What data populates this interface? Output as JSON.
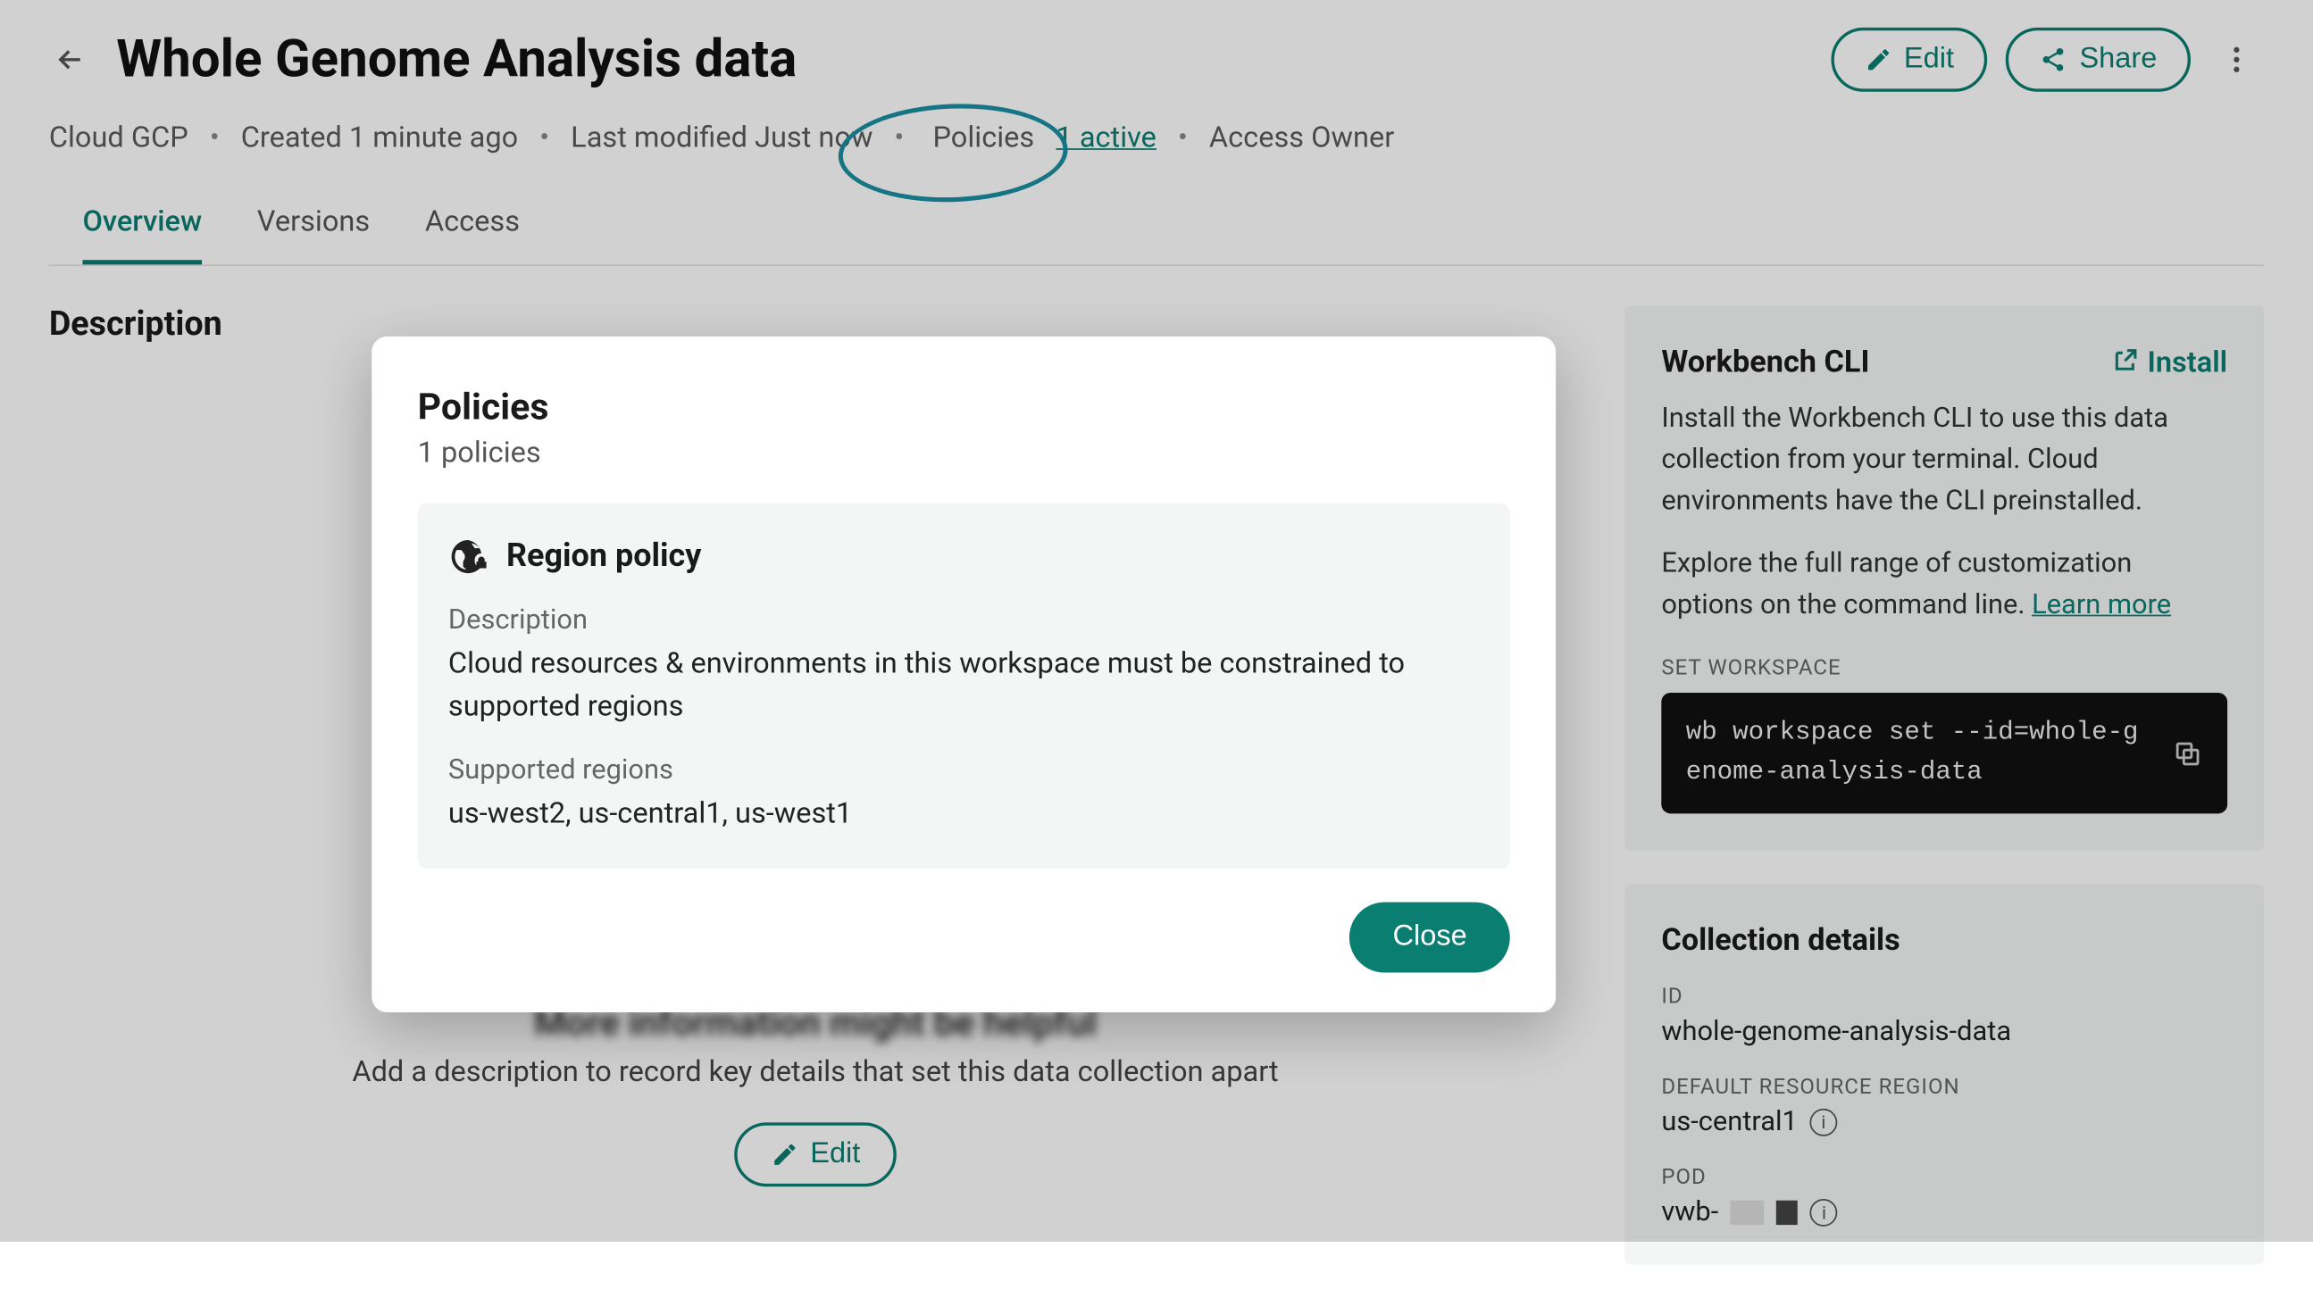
{
  "header": {
    "title": "Whole Genome Analysis data",
    "edit_label": "Edit",
    "share_label": "Share"
  },
  "meta": {
    "cloud": "Cloud GCP",
    "created": "Created 1 minute ago",
    "modified": "Last modified Just now",
    "policies_label": "Policies",
    "policies_active": "1 active",
    "access": "Access Owner"
  },
  "tabs": {
    "overview": "Overview",
    "versions": "Versions",
    "access": "Access"
  },
  "description": {
    "heading": "Description",
    "blurred_text": "More information might be helpful",
    "subtext": "Add a description to record key details that set this data collection apart",
    "edit_label": "Edit"
  },
  "cli": {
    "title": "Workbench CLI",
    "install": "Install",
    "body1": "Install the Workbench CLI to use this data collection from your terminal. Cloud environments have the CLI preinstalled.",
    "body2_prefix": "Explore the full range of customization options on the command line. ",
    "learn_more": "Learn more",
    "set_label": "SET WORKSPACE",
    "command": "wb workspace set --id=whole-genome-analysis-data"
  },
  "details": {
    "heading": "Collection details",
    "id_label": "ID",
    "id_value": "whole-genome-analysis-data",
    "region_label": "DEFAULT RESOURCE REGION",
    "region_value": "us-central1",
    "pod_label": "POD",
    "pod_prefix": "vwb-"
  },
  "modal": {
    "title": "Policies",
    "count": "1 policies",
    "policy_name": "Region policy",
    "desc_label": "Description",
    "desc_value": "Cloud resources & environments in this workspace must be constrained to supported regions",
    "regions_label": "Supported regions",
    "regions_value": "us-west2, us-central1, us-west1",
    "close": "Close"
  }
}
